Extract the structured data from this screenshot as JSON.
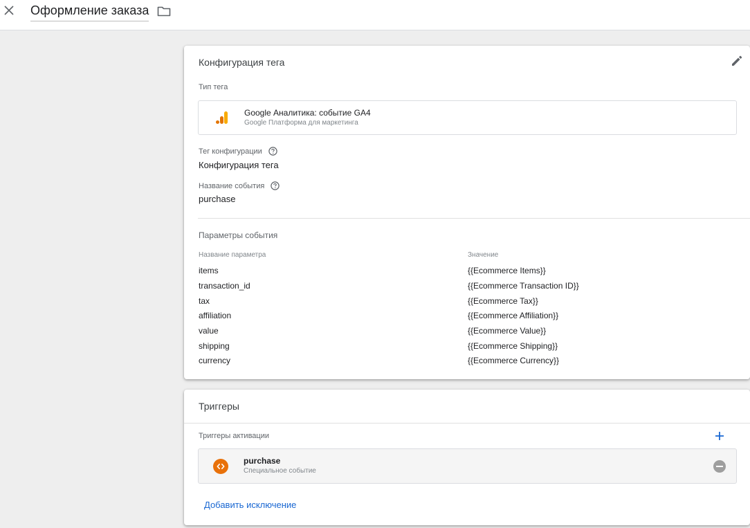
{
  "header": {
    "title": "Оформление заказа"
  },
  "tag_config": {
    "card_title": "Конфигурация тега",
    "tag_type_label": "Тип тега",
    "tag_type": {
      "name": "Google Аналитика: событие GA4",
      "subtitle": "Google Платформа для маркетинга",
      "icon": "ga4-analytics-icon"
    },
    "config_tag_label": "Тег конфигурации",
    "config_tag_value": "Конфигурация тега",
    "event_name_label": "Название события",
    "event_name_value": "purchase",
    "event_params": {
      "title": "Параметры события",
      "col_name": "Название параметра",
      "col_value": "Значение",
      "rows": [
        {
          "name": "items",
          "value": "{{Ecommerce Items}}"
        },
        {
          "name": "transaction_id",
          "value": "{{Ecommerce Transaction ID}}"
        },
        {
          "name": "tax",
          "value": "{{Ecommerce Tax}}"
        },
        {
          "name": "affiliation",
          "value": "{{Ecommerce Affiliation}}"
        },
        {
          "name": "value",
          "value": "{{Ecommerce Value}}"
        },
        {
          "name": "shipping",
          "value": "{{Ecommerce Shipping}}"
        },
        {
          "name": "currency",
          "value": "{{Ecommerce Currency}}"
        }
      ]
    }
  },
  "triggers": {
    "card_title": "Триггеры",
    "firing_label": "Триггеры активации",
    "items": [
      {
        "name": "purchase",
        "subtitle": "Специальное событие",
        "icon": "custom-event-icon"
      }
    ],
    "add_exception": "Добавить исключение"
  },
  "colors": {
    "accent": "#1967d2",
    "trigger_icon": "#e8710a",
    "ga_dark": "#e37400",
    "ga_light": "#f9ab00"
  }
}
